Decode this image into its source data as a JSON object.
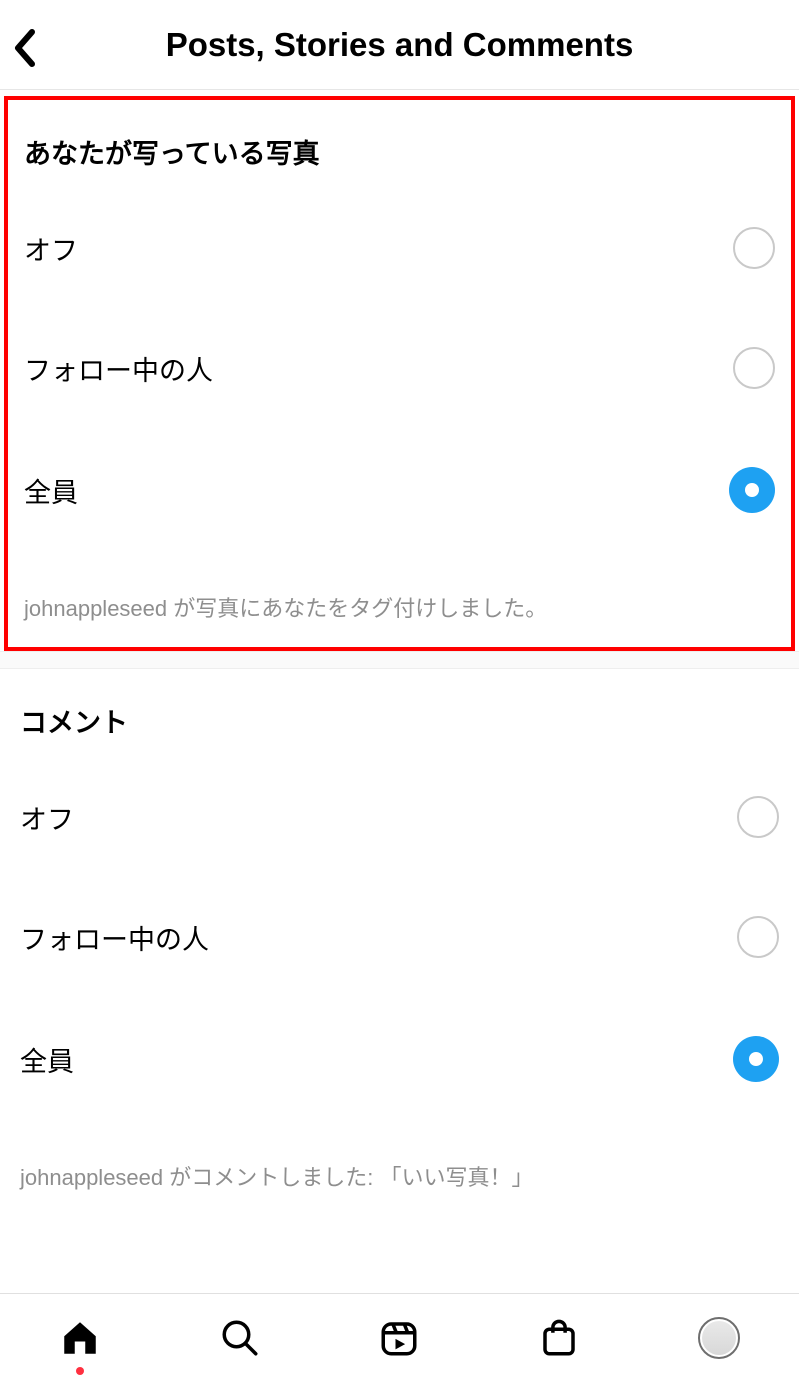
{
  "header": {
    "title": "Posts, Stories and Comments"
  },
  "section1": {
    "title": "あなたが写っている写真",
    "options": [
      {
        "label": "オフ",
        "selected": false
      },
      {
        "label": "フォロー中の人",
        "selected": false
      },
      {
        "label": "全員",
        "selected": true
      }
    ],
    "helper": "johnappleseed が写真にあなたをタグ付けしました。"
  },
  "section2": {
    "title": "コメント",
    "options": [
      {
        "label": "オフ",
        "selected": false
      },
      {
        "label": "フォロー中の人",
        "selected": false
      },
      {
        "label": "全員",
        "selected": true
      }
    ],
    "helper": "johnappleseed がコメントしました:  「いい写真！」"
  }
}
